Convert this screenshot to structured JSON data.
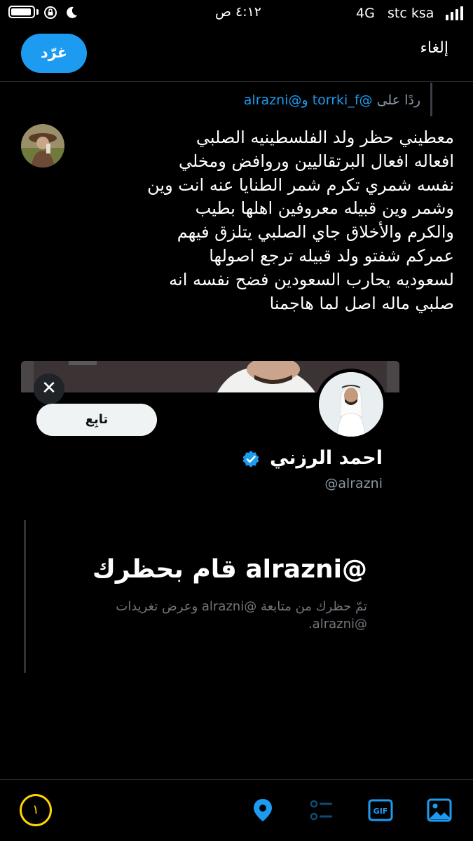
{
  "status_bar": {
    "time": "٤:١٢ ص",
    "network": "4G",
    "carrier": "stc ksa"
  },
  "top_bar": {
    "tweet_button": "غرّد",
    "cancel": "إلغاء"
  },
  "reply_context": {
    "prefix": "ردًا على",
    "user1": "@torrki_f",
    "conjunction": "و",
    "user2": "@alrazni"
  },
  "compose": {
    "lines": [
      "معطيني حظر ولد الفلسطينيه الصلبي",
      "افعاله افعال البرتقاليين وروافض ومخلي",
      "نفسه شمري تكرم شمر الطنايا عنه  انت وين",
      "وشمر وين  قبيله معروفين اهلها بطيب",
      "والكرم والأخلاق جاي الصلبي يتلزق فيهم",
      "عمركم شفتو ولد قبيله ترجع اصولها",
      "لسعوديه يحارب السعودين فضح نفسه انه",
      "صلبي ماله اصل لما هاجمنا"
    ]
  },
  "quote_card": {
    "close_icon": "✕",
    "follow_label": "تابِع",
    "name": "احمد الرزني",
    "handle": "@alrazni",
    "verified_color": "#1d9bf0"
  },
  "blocked_notice": {
    "title": "@alrazni قام بحظرك",
    "description": "تمّ حظرك من متابعة @alrazni وعرض تغريدات @alrazni."
  },
  "toolbar": {
    "char_counter": "١",
    "icons": [
      "location-icon",
      "poll-icon",
      "gif-icon",
      "image-icon"
    ],
    "gif_label": "GIF",
    "accent": "#1d9bf0",
    "counter_color": "#ffd400"
  }
}
